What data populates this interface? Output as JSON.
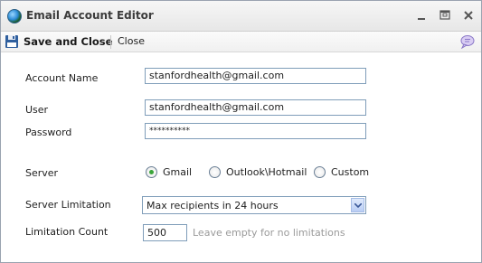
{
  "window": {
    "title": "Email Account Editor"
  },
  "toolbar": {
    "save_close_label": "Save and Close",
    "close_label": "Close"
  },
  "form": {
    "account_name": {
      "label": "Account Name",
      "value": "stanfordhealth@gmail.com"
    },
    "user": {
      "label": "User",
      "value": "stanfordhealth@gmail.com"
    },
    "password": {
      "label": "Password",
      "value": "**********"
    },
    "server": {
      "label": "Server",
      "options": [
        "Gmail",
        "Outlook\\Hotmail",
        "Custom"
      ],
      "selected": "Gmail"
    },
    "server_limitation": {
      "label": "Server Limitation",
      "value": "Max recipients in 24 hours"
    },
    "limitation_count": {
      "label": "Limitation Count",
      "value": "500",
      "hint": "Leave empty for no limitations"
    }
  },
  "colors": {
    "accent_radio": "#3aa53a",
    "input_border": "#7f9db9"
  },
  "icons": {
    "app": "globe-icon",
    "save": "floppy-disk-icon",
    "help": "speech-bubble-icon"
  }
}
